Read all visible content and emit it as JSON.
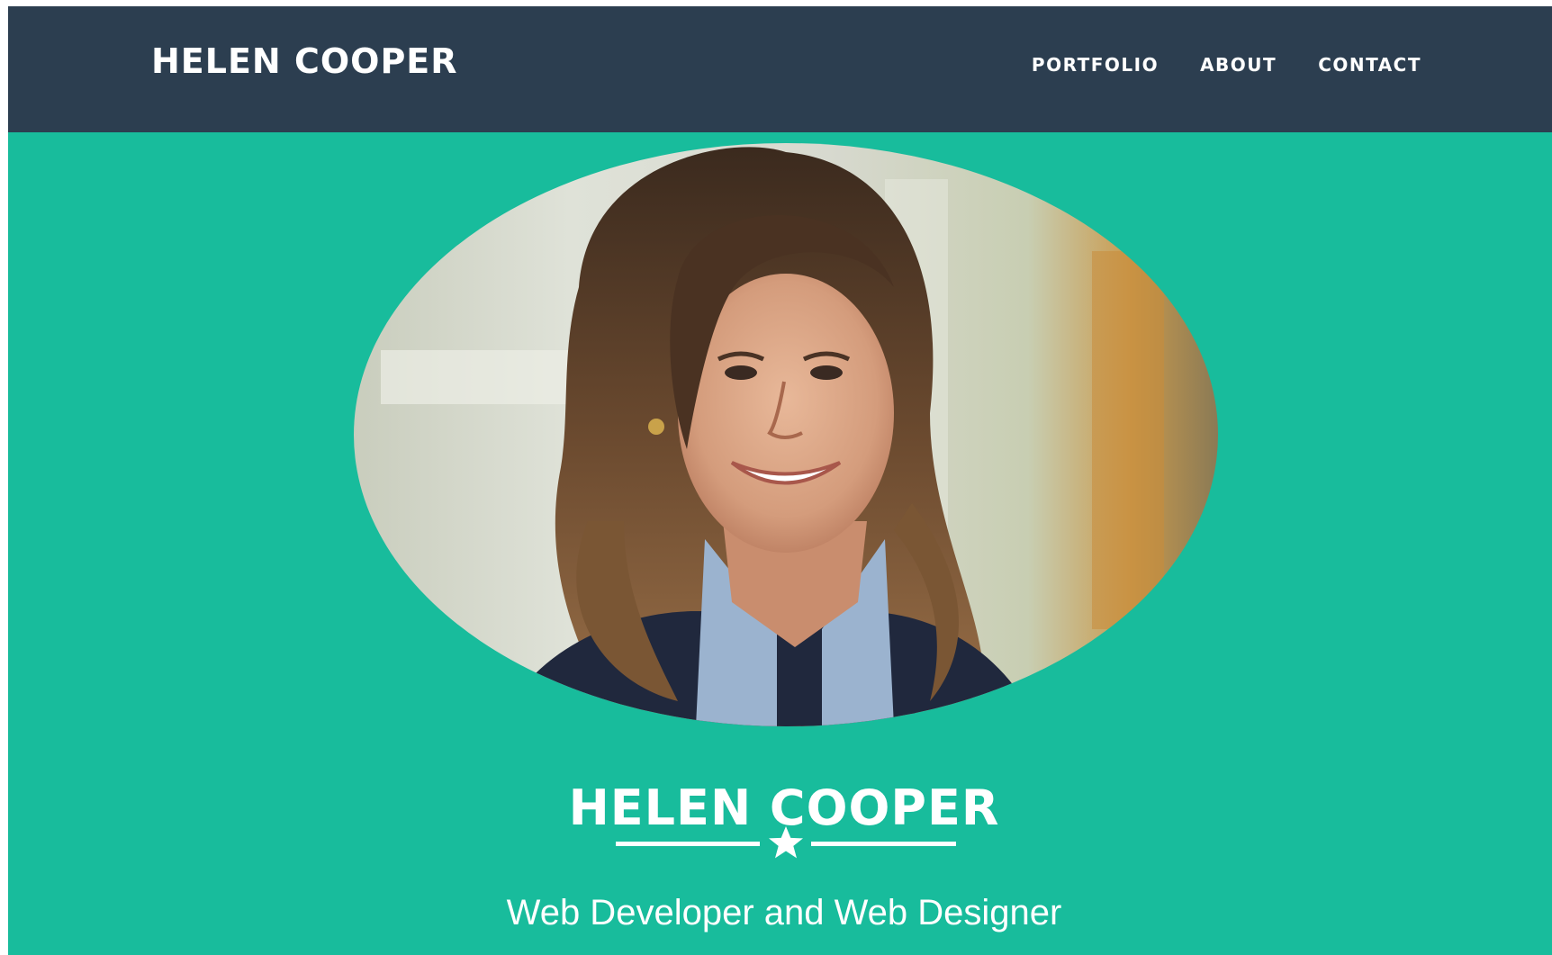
{
  "navbar": {
    "brand": "HELEN COOPER",
    "links": [
      {
        "label": "PORTFOLIO"
      },
      {
        "label": "ABOUT"
      },
      {
        "label": "CONTACT"
      }
    ]
  },
  "hero": {
    "name": "HELEN COOPER",
    "tagline": "Web Developer and Web Designer",
    "divider_icon": "star-icon"
  },
  "colors": {
    "navbar_bg": "#2c3e50",
    "hero_bg": "#18bc9c",
    "text": "#ffffff"
  }
}
